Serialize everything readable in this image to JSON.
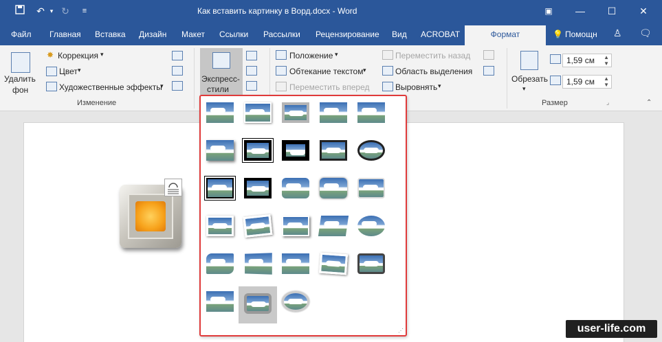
{
  "window": {
    "title": "Как вставить картинку в Ворд.docx - Word",
    "qa_icons": [
      "save-icon",
      "undo-icon",
      "redo-icon",
      "customize-icon"
    ],
    "controls": [
      "ribbon-display-icon",
      "minimize-icon",
      "maximize-icon",
      "close-icon"
    ]
  },
  "tabs": [
    {
      "label": "Файл"
    },
    {
      "label": "Главная"
    },
    {
      "label": "Вставка"
    },
    {
      "label": "Дизайн"
    },
    {
      "label": "Макет"
    },
    {
      "label": "Ссылки"
    },
    {
      "label": "Рассылки"
    },
    {
      "label": "Рецензирование"
    },
    {
      "label": "Вид"
    },
    {
      "label": "ACROBAT"
    },
    {
      "label": "Формат"
    }
  ],
  "tell_me": "Помощн",
  "ribbon": {
    "remove_bg_line1": "Удалить",
    "remove_bg_line2": "фон",
    "correction": "Коррекция",
    "color": "Цвет",
    "artistic": "Художественные эффекты",
    "group_adjust": "Изменение",
    "quick_styles_line1": "Экспресс-",
    "quick_styles_line2": "стили",
    "position": "Положение",
    "wrap_text": "Обтекание текстом",
    "bring_forward": "Переместить вперед",
    "send_backward": "Переместить назад",
    "selection_pane": "Область выделения",
    "align": "Выровнять",
    "crop": "Обрезать",
    "height": "1,59 см",
    "width": "1,59 см",
    "group_size": "Размер"
  },
  "gallery": {
    "styles": 28,
    "selected_index": 26
  },
  "watermark": "user-life.com",
  "colors": {
    "accent": "#2b579a",
    "highlight_border": "#e03a3a"
  }
}
